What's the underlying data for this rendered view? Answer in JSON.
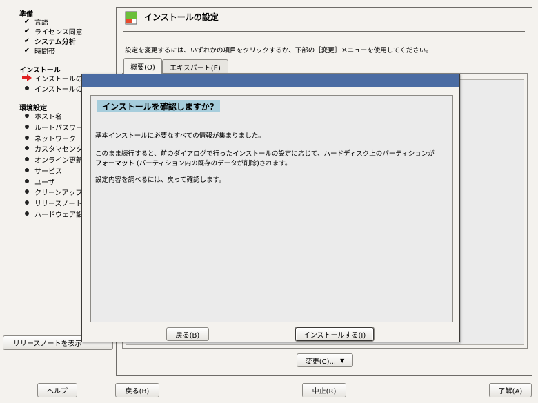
{
  "sidebar": {
    "sections": [
      {
        "title": "準備",
        "items": [
          {
            "label": "言語",
            "status": "check",
            "bold": false
          },
          {
            "label": "ライセンス同意",
            "status": "check",
            "bold": false
          },
          {
            "label": "システム分析",
            "status": "check",
            "bold": true
          },
          {
            "label": "時間帯",
            "status": "check",
            "bold": false
          }
        ]
      },
      {
        "title": "インストール",
        "items": [
          {
            "label": "インストールの",
            "status": "arrow",
            "bold": false
          },
          {
            "label": "インストールの",
            "status": "dot",
            "bold": false
          }
        ]
      },
      {
        "title": "環境設定",
        "items": [
          {
            "label": "ホスト名",
            "status": "dot",
            "bold": false
          },
          {
            "label": "ルートパスワー",
            "status": "dot",
            "bold": false
          },
          {
            "label": "ネットワーク",
            "status": "dot",
            "bold": false
          },
          {
            "label": "カスタマセンタ",
            "status": "dot",
            "bold": false
          },
          {
            "label": "オンライン更新",
            "status": "dot",
            "bold": false
          },
          {
            "label": "サービス",
            "status": "dot",
            "bold": false
          },
          {
            "label": "ユーザ",
            "status": "dot",
            "bold": false
          },
          {
            "label": "クリーンアップ",
            "status": "dot",
            "bold": false
          },
          {
            "label": "リリースノート",
            "status": "dot",
            "bold": false
          },
          {
            "label": "ハードウェア設",
            "status": "dot",
            "bold": false
          }
        ]
      }
    ],
    "release_notes_button": "リリースノートを表示"
  },
  "main": {
    "title": "インストールの設定",
    "instruction": "設定を変更するには、いずれかの項目をクリックするか、下部の［変更］メニューを使用してください。",
    "tabs": [
      {
        "label": "概要(O)",
        "active": true
      },
      {
        "label": "エキスパート(E)",
        "active": false
      }
    ],
    "change_button": "変更(C)...",
    "change_arrow": "▼"
  },
  "dialog": {
    "heading": "インストールを確認しますか?",
    "para1": "基本インストールに必要なすべての情報が集まりました。",
    "para2_a": "このまま続行すると、前のダイアログで行ったインストールの設定に応じて、ハードディスク上のパーティションが",
    "para2_b_bold": "フォーマット",
    "para2_b_rest": " (パーティション内の既存のデータが削除)されます。",
    "para3": "設定内容を調べるには、戻って確認します。",
    "back_button": "戻る(B)",
    "install_button": "インストールする(I)"
  },
  "footer": {
    "help": "ヘルプ",
    "back": "戻る(B)",
    "abort": "中止(R)",
    "accept": "了解(A)"
  },
  "colors": {
    "dialog_titlebar": "#4b6ca3",
    "heading_band": "#a6cddc",
    "arrow": "#e02020",
    "background": "#f4f2ee"
  }
}
